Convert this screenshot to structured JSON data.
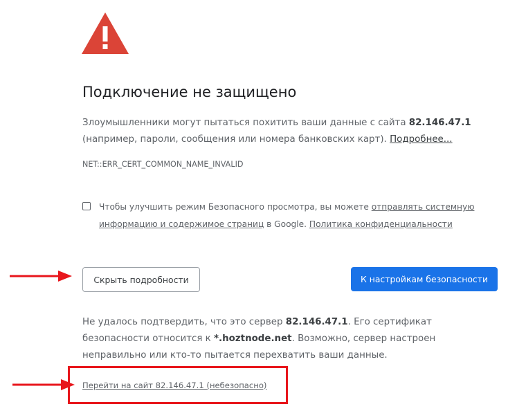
{
  "page": {
    "title": "Подключение не защищено",
    "main_text": {
      "part1": "Злоумышленники могут пытаться похитить ваши данные с сайта",
      "host": "82.146.47.1",
      "part2": "(например, пароли, сообщения или номера банковских карт).",
      "learn_more": "Подробнее..."
    },
    "error_code": "NET::ERR_CERT_COMMON_NAME_INVALID",
    "optin": {
      "part1": "Чтобы улучшить режим Безопасного просмотра, вы можете",
      "link1": "отправлять системную информацию и содержимое страниц",
      "part2": "в Google.",
      "link2": "Политика конфиденциальности"
    },
    "buttons": {
      "details": "Скрыть подробности",
      "back_to_safety": "К настройкам безопасности"
    },
    "details": {
      "part1": "Не удалось подтвердить, что это сервер",
      "host": "82.146.47.1",
      "part2": ". Его сертификат безопасности относится к",
      "cert_domain": "*.hoztnode.net",
      "part3": ". Возможно, сервер настроен неправильно или кто-то пытается перехватить ваши данные."
    },
    "proceed_link": "Перейти на сайт 82.146.47.1 (небезопасно)"
  },
  "icons": {
    "warning": "warning-triangle-icon",
    "arrow": "red-arrow-icon"
  },
  "colors": {
    "warning_red": "#db4437",
    "primary_blue": "#1a73e8",
    "annotation_red": "#e8161c",
    "body_text": "#5f6368",
    "heading_text": "#202124"
  }
}
